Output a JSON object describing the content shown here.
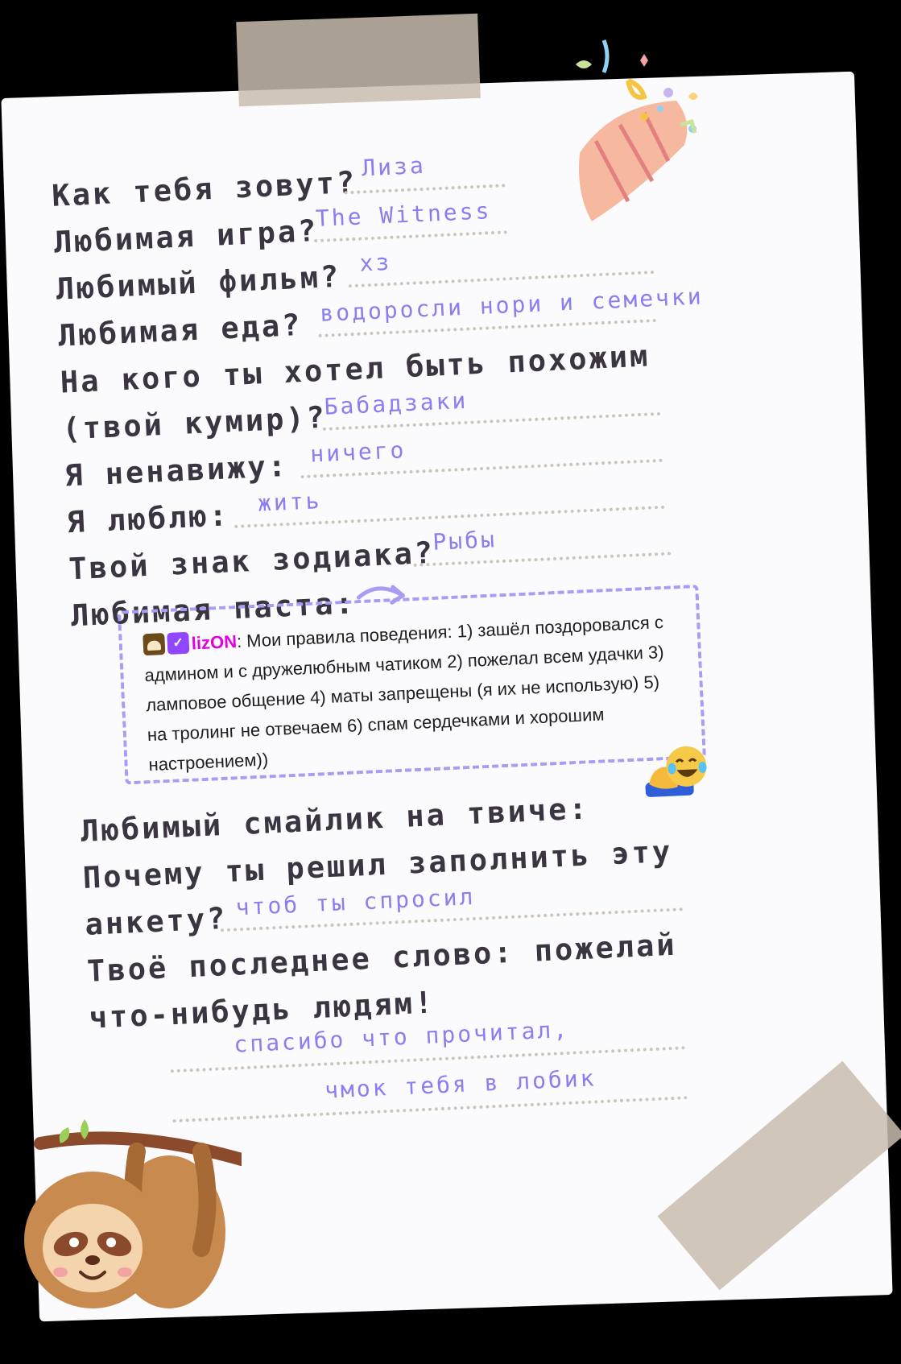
{
  "questions": {
    "name": {
      "label": "Как тебя зовут?",
      "answer": "Лиза"
    },
    "game": {
      "label": "Любимая игра?",
      "answer": "The Witness"
    },
    "film": {
      "label": "Любимый фильм?",
      "answer": "хз"
    },
    "food": {
      "label": "Любимая еда?",
      "answer": "водоросли нори и семечки"
    },
    "idol": {
      "label_line1": "На кого ты хотел быть похожим",
      "label_line2": "(твой кумир)?",
      "answer": "Бабадзаки"
    },
    "hate": {
      "label": "Я ненавижу:",
      "answer": "ничего"
    },
    "love": {
      "label": "Я люблю:",
      "answer": "жить"
    },
    "zodiac": {
      "label": "Твой знак зодиака?",
      "answer": "Рыбы"
    },
    "paste": {
      "label": "Любимая паста:"
    },
    "emote": {
      "label": "Любимый смайлик на твиче:"
    },
    "why": {
      "label_line1": "Почему ты решил заполнить эту",
      "label_line2": "анкету?",
      "answer": "чтоб ты спросил"
    },
    "last": {
      "label_line1": "Твоё последнее слово: пожелай",
      "label_line2": "что-нибудь людям!",
      "answer_line1": "спасибо что прочитал,",
      "answer_line2": "чмок тебя в лобик"
    }
  },
  "paste_message": {
    "username": "lizON",
    "text": ": Мои правила поведения: 1) зашёл поздоровался с админом и с дружелюбным чатиком 2) пожелал всем удачки 3) ламповое общение 4) маты запрещены (я их не использую) 5) на тролинг не отвечаем 6) спам сердечками и хорошим настроением))"
  },
  "icons": {
    "badge1": "moderator-badge-icon",
    "badge2": "verified-badge-icon",
    "emote": "laughing-emote-icon",
    "party": "party-popper-icon",
    "sloth": "sloth-icon",
    "arrow": "curved-arrow-icon"
  },
  "colors": {
    "text": "#3a3540",
    "answer": "#8a7ef0",
    "username": "#e000e0",
    "dash": "#a99cf4"
  }
}
